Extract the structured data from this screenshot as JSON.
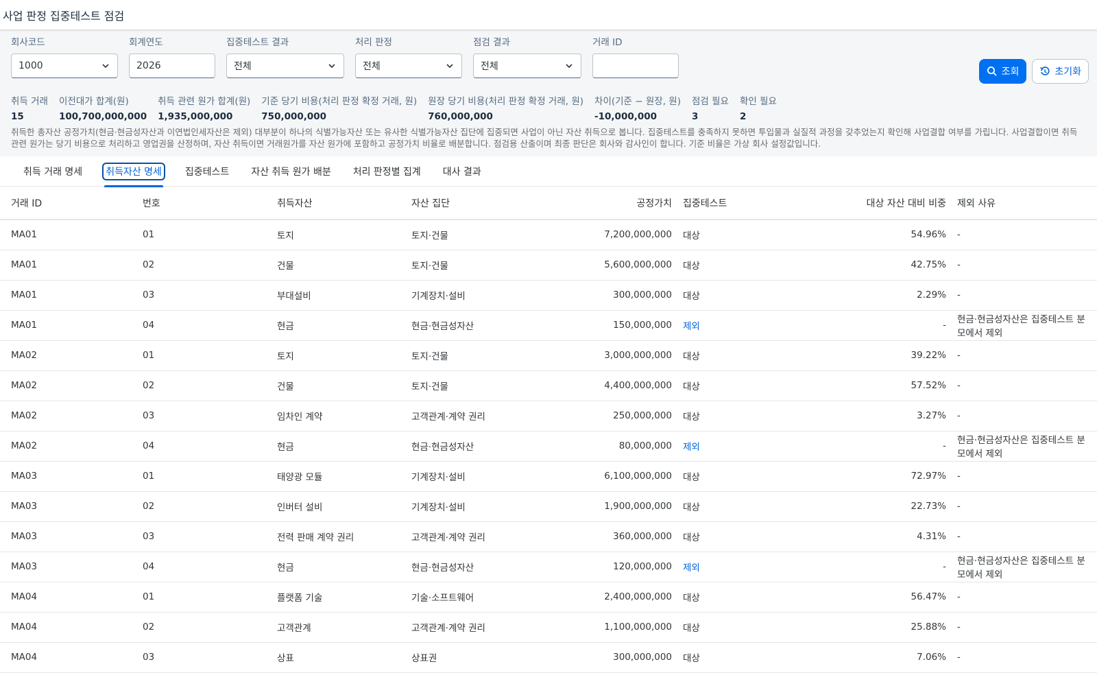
{
  "page_title": "사업 판정 집중테스트 점검",
  "filters": {
    "company_code": {
      "label": "회사코드",
      "value": "1000"
    },
    "fiscal_year": {
      "label": "회계연도",
      "value": "2026"
    },
    "conc_test_result": {
      "label": "집중테스트 결과",
      "value": "전체"
    },
    "treatment": {
      "label": "처리 판정",
      "value": "전체"
    },
    "check_result": {
      "label": "점검 결과",
      "value": "전체"
    },
    "deal_id": {
      "label": "거래 ID",
      "value": ""
    }
  },
  "buttons": {
    "search": "조회",
    "reset": "초기화"
  },
  "kpis": [
    {
      "label": "취득 거래",
      "value": "15"
    },
    {
      "label": "이전대가 합계(원)",
      "value": "100,700,000,000"
    },
    {
      "label": "취득 관련 원가 합계(원)",
      "value": "1,935,000,000"
    },
    {
      "label": "기준 당기 비용(처리 판정 확정 거래, 원)",
      "value": "750,000,000"
    },
    {
      "label": "원장 당기 비용(처리 판정 확정 거래, 원)",
      "value": "760,000,000"
    },
    {
      "label": "차이(기준 − 원장, 원)",
      "value": "-10,000,000"
    },
    {
      "label": "점검 필요",
      "value": "3"
    },
    {
      "label": "확인 필요",
      "value": "2"
    }
  ],
  "note": "취득한 총자산 공정가치(현금·현금성자산과 이연법인세자산은 제외) 대부분이 하나의 식별가능자산 또는 유사한 식별가능자산 집단에 집중되면 사업이 아닌 자산 취득으로 봅니다. 집중테스트를 충족하지 못하면 투입물과 실질적 과정을 갖추었는지 확인해 사업결합 여부를 가립니다. 사업결합이면 취득 관련 원가는 당기 비용으로 처리하고 영업권을 산정하며, 자산 취득이면 거래원가를 자산 원가에 포함하고 공정가치 비율로 배분합니다. 점검용 산출이며 최종 판단은 회사와 감사인이 합니다. 기준 비율은 가상 회사 설정값입니다.",
  "tabs": [
    "취득 거래 명세",
    "취득자산 명세",
    "집중테스트",
    "자산 취득 원가 배분",
    "처리 판정별 집계",
    "대사 결과"
  ],
  "table": {
    "columns": [
      "거래 ID",
      "번호",
      "취득자산",
      "자산 집단",
      "공정가치",
      "집중테스트",
      "대상 자산 대비 비중",
      "제외 사유"
    ],
    "rows": [
      [
        "MA01",
        "01",
        "토지",
        "토지·건물",
        "7,200,000,000",
        "대상",
        "54.96%",
        "-"
      ],
      [
        "MA01",
        "02",
        "건물",
        "토지·건물",
        "5,600,000,000",
        "대상",
        "42.75%",
        "-"
      ],
      [
        "MA01",
        "03",
        "부대설비",
        "기계장치·설비",
        "300,000,000",
        "대상",
        "2.29%",
        "-"
      ],
      [
        "MA01",
        "04",
        "현금",
        "현금·현금성자산",
        "150,000,000",
        "제외",
        "-",
        "현금·현금성자산은 집중테스트 분모에서 제외"
      ],
      [
        "MA02",
        "01",
        "토지",
        "토지·건물",
        "3,000,000,000",
        "대상",
        "39.22%",
        "-"
      ],
      [
        "MA02",
        "02",
        "건물",
        "토지·건물",
        "4,400,000,000",
        "대상",
        "57.52%",
        "-"
      ],
      [
        "MA02",
        "03",
        "임차인 계약",
        "고객관계·계약 권리",
        "250,000,000",
        "대상",
        "3.27%",
        "-"
      ],
      [
        "MA02",
        "04",
        "현금",
        "현금·현금성자산",
        "80,000,000",
        "제외",
        "-",
        "현금·현금성자산은 집중테스트 분모에서 제외"
      ],
      [
        "MA03",
        "01",
        "태양광 모듈",
        "기계장치·설비",
        "6,100,000,000",
        "대상",
        "72.97%",
        "-"
      ],
      [
        "MA03",
        "02",
        "인버터 설비",
        "기계장치·설비",
        "1,900,000,000",
        "대상",
        "22.73%",
        "-"
      ],
      [
        "MA03",
        "03",
        "전력 판매 계약 권리",
        "고객관계·계약 권리",
        "360,000,000",
        "대상",
        "4.31%",
        "-"
      ],
      [
        "MA03",
        "04",
        "현금",
        "현금·현금성자산",
        "120,000,000",
        "제외",
        "-",
        "현금·현금성자산은 집중테스트 분모에서 제외"
      ],
      [
        "MA04",
        "01",
        "플랫폼 기술",
        "기술·소프트웨어",
        "2,400,000,000",
        "대상",
        "56.47%",
        "-"
      ],
      [
        "MA04",
        "02",
        "고객관계",
        "고객관계·계약 권리",
        "1,100,000,000",
        "대상",
        "25.88%",
        "-"
      ],
      [
        "MA04",
        "03",
        "상표",
        "상표권",
        "300,000,000",
        "대상",
        "7.06%",
        "-"
      ]
    ]
  }
}
